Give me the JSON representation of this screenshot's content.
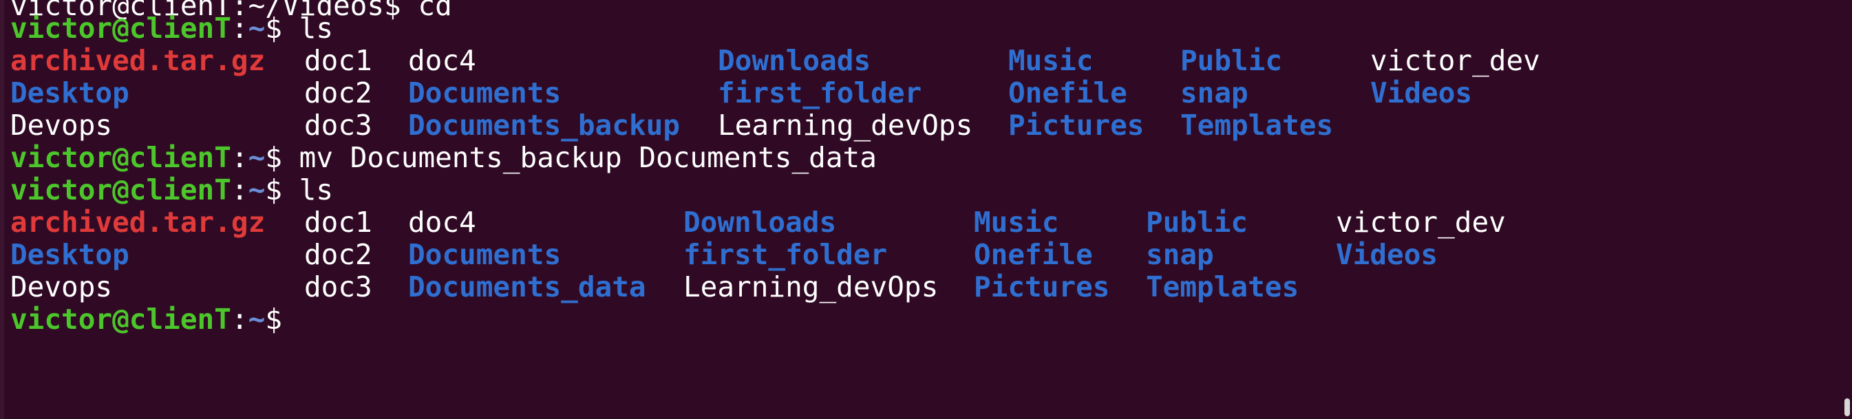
{
  "prompt": {
    "user": "victor@clienT",
    "path": "~",
    "symbol": "$"
  },
  "top_partial": "victor@clienT:~/Videos$ cd",
  "lines": [
    {
      "type": "cmd",
      "text": "ls"
    },
    {
      "type": "ls",
      "row": [
        {
          "name": "archived.tar.gz",
          "kind": "archive"
        },
        {
          "name": "doc1",
          "kind": "file"
        },
        {
          "name": "doc4",
          "kind": "file"
        },
        {
          "name": "Downloads",
          "kind": "dir"
        },
        {
          "name": "Music",
          "kind": "dir"
        },
        {
          "name": "Public",
          "kind": "dir"
        },
        {
          "name": "victor_dev",
          "kind": "file"
        }
      ]
    },
    {
      "type": "ls",
      "row": [
        {
          "name": "Desktop",
          "kind": "dir"
        },
        {
          "name": "doc2",
          "kind": "file"
        },
        {
          "name": "Documents",
          "kind": "dir"
        },
        {
          "name": "first_folder",
          "kind": "dir"
        },
        {
          "name": "Onefile",
          "kind": "dir"
        },
        {
          "name": "snap",
          "kind": "dir"
        },
        {
          "name": "Videos",
          "kind": "dir"
        }
      ]
    },
    {
      "type": "ls",
      "row": [
        {
          "name": "Devops",
          "kind": "file"
        },
        {
          "name": "doc3",
          "kind": "file"
        },
        {
          "name": "Documents_backup",
          "kind": "dir"
        },
        {
          "name": "Learning_devOps",
          "kind": "file"
        },
        {
          "name": "Pictures",
          "kind": "dir"
        },
        {
          "name": "Templates",
          "kind": "dir"
        }
      ]
    },
    {
      "type": "cmd",
      "text": "mv Documents_backup Documents_data"
    },
    {
      "type": "cmd",
      "text": "ls"
    },
    {
      "type": "ls",
      "row": [
        {
          "name": "archived.tar.gz",
          "kind": "archive"
        },
        {
          "name": "doc1",
          "kind": "file"
        },
        {
          "name": "doc4",
          "kind": "file"
        },
        {
          "name": "Downloads",
          "kind": "dir"
        },
        {
          "name": "Music",
          "kind": "dir"
        },
        {
          "name": "Public",
          "kind": "dir"
        },
        {
          "name": "victor_dev",
          "kind": "file"
        }
      ]
    },
    {
      "type": "ls",
      "row": [
        {
          "name": "Desktop",
          "kind": "dir"
        },
        {
          "name": "doc2",
          "kind": "file"
        },
        {
          "name": "Documents",
          "kind": "dir"
        },
        {
          "name": "first_folder",
          "kind": "dir"
        },
        {
          "name": "Onefile",
          "kind": "dir"
        },
        {
          "name": "snap",
          "kind": "dir"
        },
        {
          "name": "Videos",
          "kind": "dir"
        }
      ]
    },
    {
      "type": "ls",
      "row": [
        {
          "name": "Devops",
          "kind": "file"
        },
        {
          "name": "doc3",
          "kind": "file"
        },
        {
          "name": "Documents_data",
          "kind": "dir"
        },
        {
          "name": "Learning_devOps",
          "kind": "file"
        },
        {
          "name": "Pictures",
          "kind": "dir"
        },
        {
          "name": "Templates",
          "kind": "dir"
        }
      ]
    },
    {
      "type": "cmd",
      "text": ""
    }
  ],
  "colors": {
    "background": "#300a24",
    "prompt_user": "#4cc72b",
    "prompt_path": "#6a8fd9",
    "directory": "#2f6fd1",
    "archive": "#e03a3a",
    "plain": "#ffffff"
  }
}
